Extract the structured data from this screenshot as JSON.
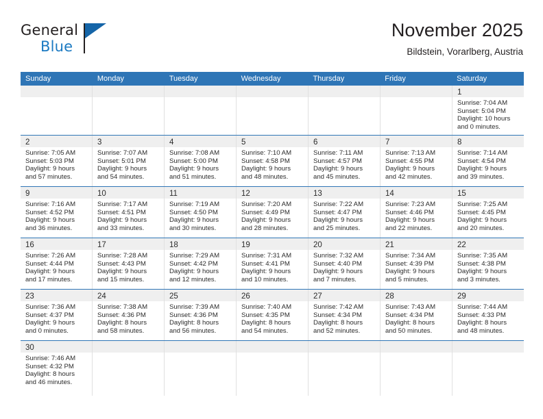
{
  "brand": {
    "name_top": "General",
    "name_bottom": "Blue",
    "flag_color": "#1565a8",
    "blue_color": "#1b7ac2"
  },
  "header": {
    "month_title": "November 2025",
    "location": "Bildstein, Vorarlberg, Austria",
    "accent_color": "#2e75b6"
  },
  "calendar": {
    "day_headers": [
      "Sunday",
      "Monday",
      "Tuesday",
      "Wednesday",
      "Thursday",
      "Friday",
      "Saturday"
    ],
    "weeks": [
      [
        {
          "blank": true
        },
        {
          "blank": true
        },
        {
          "blank": true
        },
        {
          "blank": true
        },
        {
          "blank": true
        },
        {
          "blank": true
        },
        {
          "day": "1",
          "sunrise": "Sunrise: 7:04 AM",
          "sunset": "Sunset: 5:04 PM",
          "daylight1": "Daylight: 10 hours",
          "daylight2": "and 0 minutes."
        }
      ],
      [
        {
          "day": "2",
          "sunrise": "Sunrise: 7:05 AM",
          "sunset": "Sunset: 5:03 PM",
          "daylight1": "Daylight: 9 hours",
          "daylight2": "and 57 minutes."
        },
        {
          "day": "3",
          "sunrise": "Sunrise: 7:07 AM",
          "sunset": "Sunset: 5:01 PM",
          "daylight1": "Daylight: 9 hours",
          "daylight2": "and 54 minutes."
        },
        {
          "day": "4",
          "sunrise": "Sunrise: 7:08 AM",
          "sunset": "Sunset: 5:00 PM",
          "daylight1": "Daylight: 9 hours",
          "daylight2": "and 51 minutes."
        },
        {
          "day": "5",
          "sunrise": "Sunrise: 7:10 AM",
          "sunset": "Sunset: 4:58 PM",
          "daylight1": "Daylight: 9 hours",
          "daylight2": "and 48 minutes."
        },
        {
          "day": "6",
          "sunrise": "Sunrise: 7:11 AM",
          "sunset": "Sunset: 4:57 PM",
          "daylight1": "Daylight: 9 hours",
          "daylight2": "and 45 minutes."
        },
        {
          "day": "7",
          "sunrise": "Sunrise: 7:13 AM",
          "sunset": "Sunset: 4:55 PM",
          "daylight1": "Daylight: 9 hours",
          "daylight2": "and 42 minutes."
        },
        {
          "day": "8",
          "sunrise": "Sunrise: 7:14 AM",
          "sunset": "Sunset: 4:54 PM",
          "daylight1": "Daylight: 9 hours",
          "daylight2": "and 39 minutes."
        }
      ],
      [
        {
          "day": "9",
          "sunrise": "Sunrise: 7:16 AM",
          "sunset": "Sunset: 4:52 PM",
          "daylight1": "Daylight: 9 hours",
          "daylight2": "and 36 minutes."
        },
        {
          "day": "10",
          "sunrise": "Sunrise: 7:17 AM",
          "sunset": "Sunset: 4:51 PM",
          "daylight1": "Daylight: 9 hours",
          "daylight2": "and 33 minutes."
        },
        {
          "day": "11",
          "sunrise": "Sunrise: 7:19 AM",
          "sunset": "Sunset: 4:50 PM",
          "daylight1": "Daylight: 9 hours",
          "daylight2": "and 30 minutes."
        },
        {
          "day": "12",
          "sunrise": "Sunrise: 7:20 AM",
          "sunset": "Sunset: 4:49 PM",
          "daylight1": "Daylight: 9 hours",
          "daylight2": "and 28 minutes."
        },
        {
          "day": "13",
          "sunrise": "Sunrise: 7:22 AM",
          "sunset": "Sunset: 4:47 PM",
          "daylight1": "Daylight: 9 hours",
          "daylight2": "and 25 minutes."
        },
        {
          "day": "14",
          "sunrise": "Sunrise: 7:23 AM",
          "sunset": "Sunset: 4:46 PM",
          "daylight1": "Daylight: 9 hours",
          "daylight2": "and 22 minutes."
        },
        {
          "day": "15",
          "sunrise": "Sunrise: 7:25 AM",
          "sunset": "Sunset: 4:45 PM",
          "daylight1": "Daylight: 9 hours",
          "daylight2": "and 20 minutes."
        }
      ],
      [
        {
          "day": "16",
          "sunrise": "Sunrise: 7:26 AM",
          "sunset": "Sunset: 4:44 PM",
          "daylight1": "Daylight: 9 hours",
          "daylight2": "and 17 minutes."
        },
        {
          "day": "17",
          "sunrise": "Sunrise: 7:28 AM",
          "sunset": "Sunset: 4:43 PM",
          "daylight1": "Daylight: 9 hours",
          "daylight2": "and 15 minutes."
        },
        {
          "day": "18",
          "sunrise": "Sunrise: 7:29 AM",
          "sunset": "Sunset: 4:42 PM",
          "daylight1": "Daylight: 9 hours",
          "daylight2": "and 12 minutes."
        },
        {
          "day": "19",
          "sunrise": "Sunrise: 7:31 AM",
          "sunset": "Sunset: 4:41 PM",
          "daylight1": "Daylight: 9 hours",
          "daylight2": "and 10 minutes."
        },
        {
          "day": "20",
          "sunrise": "Sunrise: 7:32 AM",
          "sunset": "Sunset: 4:40 PM",
          "daylight1": "Daylight: 9 hours",
          "daylight2": "and 7 minutes."
        },
        {
          "day": "21",
          "sunrise": "Sunrise: 7:34 AM",
          "sunset": "Sunset: 4:39 PM",
          "daylight1": "Daylight: 9 hours",
          "daylight2": "and 5 minutes."
        },
        {
          "day": "22",
          "sunrise": "Sunrise: 7:35 AM",
          "sunset": "Sunset: 4:38 PM",
          "daylight1": "Daylight: 9 hours",
          "daylight2": "and 3 minutes."
        }
      ],
      [
        {
          "day": "23",
          "sunrise": "Sunrise: 7:36 AM",
          "sunset": "Sunset: 4:37 PM",
          "daylight1": "Daylight: 9 hours",
          "daylight2": "and 0 minutes."
        },
        {
          "day": "24",
          "sunrise": "Sunrise: 7:38 AM",
          "sunset": "Sunset: 4:36 PM",
          "daylight1": "Daylight: 8 hours",
          "daylight2": "and 58 minutes."
        },
        {
          "day": "25",
          "sunrise": "Sunrise: 7:39 AM",
          "sunset": "Sunset: 4:36 PM",
          "daylight1": "Daylight: 8 hours",
          "daylight2": "and 56 minutes."
        },
        {
          "day": "26",
          "sunrise": "Sunrise: 7:40 AM",
          "sunset": "Sunset: 4:35 PM",
          "daylight1": "Daylight: 8 hours",
          "daylight2": "and 54 minutes."
        },
        {
          "day": "27",
          "sunrise": "Sunrise: 7:42 AM",
          "sunset": "Sunset: 4:34 PM",
          "daylight1": "Daylight: 8 hours",
          "daylight2": "and 52 minutes."
        },
        {
          "day": "28",
          "sunrise": "Sunrise: 7:43 AM",
          "sunset": "Sunset: 4:34 PM",
          "daylight1": "Daylight: 8 hours",
          "daylight2": "and 50 minutes."
        },
        {
          "day": "29",
          "sunrise": "Sunrise: 7:44 AM",
          "sunset": "Sunset: 4:33 PM",
          "daylight1": "Daylight: 8 hours",
          "daylight2": "and 48 minutes."
        }
      ],
      [
        {
          "day": "30",
          "sunrise": "Sunrise: 7:46 AM",
          "sunset": "Sunset: 4:32 PM",
          "daylight1": "Daylight: 8 hours",
          "daylight2": "and 46 minutes."
        },
        {
          "blank": true
        },
        {
          "blank": true
        },
        {
          "blank": true
        },
        {
          "blank": true
        },
        {
          "blank": true
        },
        {
          "blank": true
        }
      ]
    ]
  }
}
